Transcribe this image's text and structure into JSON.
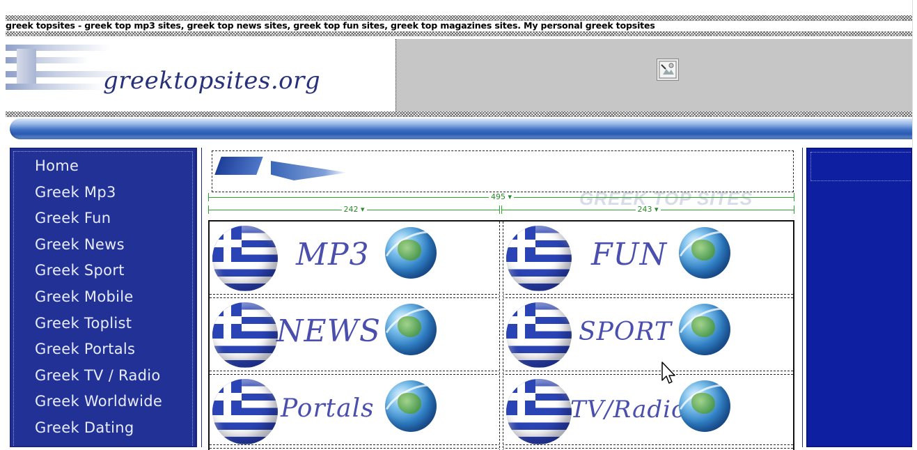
{
  "page": {
    "headline": "greek topsites - greek top mp3 sites, greek top news sites, greek top fun sites, greek top magazines sites. My personal greek topsites",
    "logo_text": "greektopsites.org",
    "watermark": "GREEK TOP SITES"
  },
  "nav": {
    "items": [
      {
        "label": "Home"
      },
      {
        "label": "Greek Mp3"
      },
      {
        "label": "Greek Fun"
      },
      {
        "label": "Greek News"
      },
      {
        "label": "Greek Sport"
      },
      {
        "label": "Greek Mobile"
      },
      {
        "label": "Greek Toplist"
      },
      {
        "label": "Greek Portals"
      },
      {
        "label": "Greek TV / Radio"
      },
      {
        "label": "Greek Worldwide"
      },
      {
        "label": "Greek Dating"
      }
    ]
  },
  "measures": {
    "table_width": "495 ▾",
    "col1_width": "242 ▾",
    "col2_width": "243 ▾"
  },
  "categories": [
    {
      "label": "MP3"
    },
    {
      "label": "FUN"
    },
    {
      "label": "NEWS"
    },
    {
      "label": "SPORT"
    },
    {
      "label": "Portals"
    },
    {
      "label": "TV/Radio"
    }
  ],
  "colors": {
    "nav_bg": "#223195",
    "right_panel_bg": "#0f1fa2",
    "category_text": "#4a4fae",
    "guide_green": "#2aa62a"
  },
  "icons": {
    "banner_placeholder": "broken-image-icon",
    "cursor": "mouse-pointer-icon"
  }
}
